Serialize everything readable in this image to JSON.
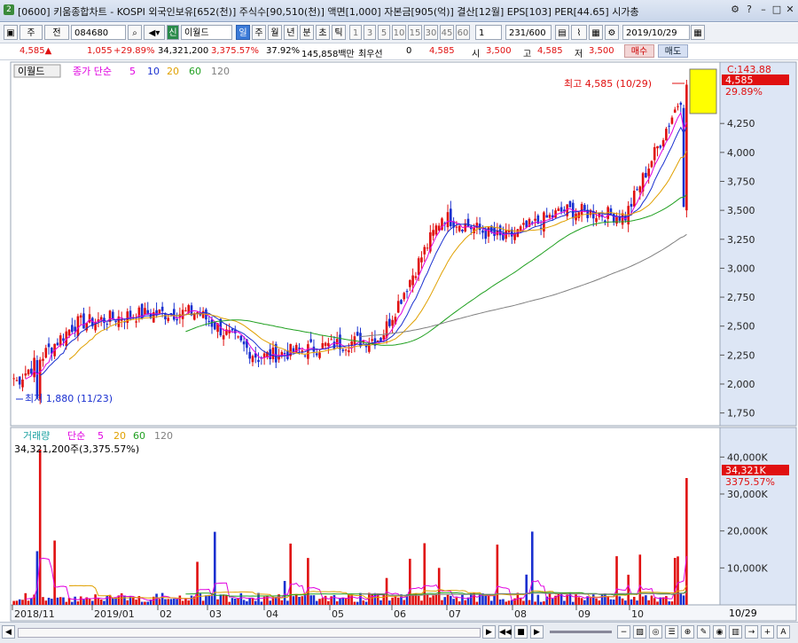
{
  "window": {
    "app_number": "2",
    "title": "[0600] 키움종합차트 - KOSPI 외국인보유[652(천)] 주식수[90,510(천)] 액면[1,000] 자본금[905(억)] 결산[12월] EPS[103] PER[44.65] 시가총"
  },
  "toolbar": {
    "period": "주",
    "prev": "전",
    "code": "084680",
    "stock_tag": "신",
    "stock_name": "이월드",
    "tabs": [
      "일",
      "주",
      "월",
      "년",
      "분",
      "초",
      "틱"
    ],
    "intervals": [
      "1",
      "3",
      "5",
      "10",
      "15",
      "30",
      "45",
      "60"
    ],
    "count_select": "1",
    "page_counter": "231",
    "page_total": "/600",
    "date": "2019/10/29"
  },
  "quote": {
    "price": "4,585",
    "change": "1,055",
    "change_pct": "+29.89%",
    "volume": "34,321,200",
    "volume_ratio": "3,375.57%",
    "turnover": "37.92%",
    "amount": "145,858백만",
    "best_label": "최우선",
    "best_value": "0",
    "ask": "4,585",
    "open_label": "시",
    "open": "3,500",
    "high_label": "고",
    "high": "4,585",
    "low_label": "저",
    "low": "3,500",
    "buy_label": "매수",
    "sell_label": "매도"
  },
  "price_panel": {
    "stock_label": "이월드",
    "ma_title": "종가 단순",
    "ma_periods": [
      "5",
      "10",
      "20",
      "60",
      "120"
    ],
    "ma_colors": [
      "#e000e0",
      "#1a30d0",
      "#e0a000",
      "#20a020",
      "#808080"
    ],
    "max_label": "최고 4,585 (10/29)",
    "min_label": "최저 1,880 (11/23)",
    "axis_c_label": "C:143.88",
    "axis_price_tag": "4,585",
    "axis_pct_tag": "29.89%",
    "y_ticks": [
      "4,250",
      "4,000",
      "3,750",
      "3,500",
      "3,250",
      "3,000",
      "2,750",
      "2,500",
      "2,250",
      "2,000",
      "1,750"
    ]
  },
  "volume_panel": {
    "title": "거래량",
    "ma_title": "단순",
    "ma_periods": [
      "5",
      "20",
      "60",
      "120"
    ],
    "info": "34,321,200주(3,375.57%)",
    "y_ticks": [
      "40,000K",
      "30,000K",
      "20,000K",
      "10,000K"
    ],
    "last_tag": "34,321K",
    "last_pct_tag": "3375.57%"
  },
  "x_axis": {
    "labels": [
      "2018/11",
      "2019/01",
      "02",
      "03",
      "04",
      "05",
      "06",
      "07",
      "08",
      "09",
      "10"
    ],
    "cursor_date": "10/29"
  },
  "colors": {
    "up": "#e01010",
    "down": "#1a30d0",
    "axis_bg": "#dde6f5",
    "highlight": "#ffff00"
  },
  "chart_data": {
    "type": "candlestick",
    "title": "이월드 (084680) 일봉",
    "x_range": [
      "2018/11",
      "2019/10/29"
    ],
    "ylim": [
      1700,
      4600
    ],
    "key_points": [
      {
        "date": "2018/11/23",
        "value": 1880,
        "note": "최저"
      },
      {
        "date": "2019/10/29",
        "value": 4585,
        "note": "최고"
      }
    ],
    "monthly_close_approx": [
      {
        "month": "2018/11",
        "close": 2000
      },
      {
        "month": "2018/12",
        "close": 2520
      },
      {
        "month": "2019/01",
        "close": 2600
      },
      {
        "month": "2019/02",
        "close": 2620
      },
      {
        "month": "2019/03",
        "close": 2230
      },
      {
        "month": "2019/04",
        "close": 2320
      },
      {
        "month": "2019/05",
        "close": 2400
      },
      {
        "month": "2019/06",
        "close": 3450
      },
      {
        "month": "2019/07",
        "close": 3250
      },
      {
        "month": "2019/08",
        "close": 3500
      },
      {
        "month": "2019/09",
        "close": 3450
      },
      {
        "month": "2019/10",
        "close": 4585
      }
    ],
    "volume_max_k": 42000,
    "last_volume_k": 34321
  }
}
